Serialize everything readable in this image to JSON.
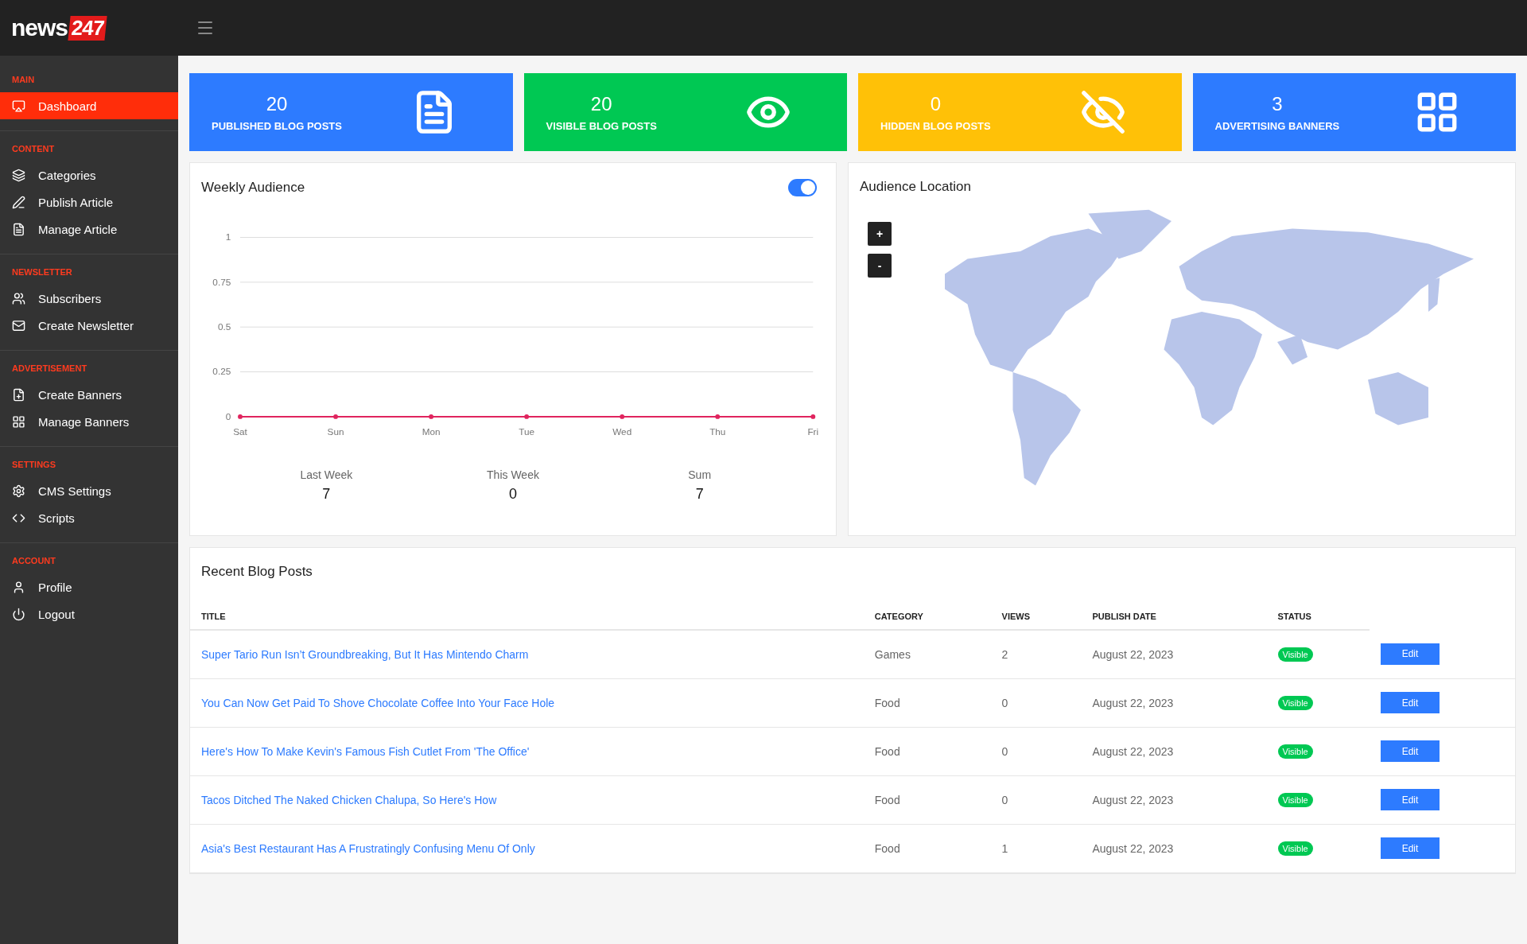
{
  "brand": {
    "name": "news",
    "number": "247"
  },
  "sidebar": {
    "sections": [
      {
        "title": "MAIN",
        "items": [
          {
            "label": "Dashboard",
            "selected": true
          }
        ]
      },
      {
        "title": "CONTENT",
        "items": [
          {
            "label": "Categories",
            "selected": false
          },
          {
            "label": "Publish Article",
            "selected": false
          },
          {
            "label": "Manage Article",
            "selected": false
          }
        ]
      },
      {
        "title": "NEWSLETTER",
        "items": [
          {
            "label": "Subscribers",
            "selected": false
          },
          {
            "label": "Create Newsletter",
            "selected": false
          }
        ]
      },
      {
        "title": "ADVERTISEMENT",
        "items": [
          {
            "label": "Create Banners",
            "selected": false
          },
          {
            "label": "Manage Banners",
            "selected": false
          }
        ]
      },
      {
        "title": "SETTINGS",
        "items": [
          {
            "label": "CMS Settings",
            "selected": false
          },
          {
            "label": "Scripts",
            "selected": false
          }
        ]
      },
      {
        "title": "ACCOUNT",
        "items": [
          {
            "label": "Profile",
            "selected": false
          },
          {
            "label": "Logout",
            "selected": false
          }
        ]
      }
    ]
  },
  "stats": [
    {
      "value": "20",
      "label": "PUBLISHED BLOG POSTS",
      "color": "#2d7bff"
    },
    {
      "value": "20",
      "label": "VISIBLE BLOG POSTS",
      "color": "#00c853"
    },
    {
      "value": "0",
      "label": "HIDDEN BLOG POSTS",
      "color": "#ffc107"
    },
    {
      "value": "3",
      "label": "ADVERTISING BANNERS",
      "color": "#2d7bff"
    }
  ],
  "weekly_audience": {
    "title": "Weekly Audience",
    "toggle": {
      "on": true
    },
    "chart_data": {
      "type": "line",
      "categories": [
        "Sat",
        "Sun",
        "Mon",
        "Tue",
        "Wed",
        "Thu",
        "Fri"
      ],
      "series": [
        {
          "color": "#e0245e",
          "marker": true,
          "values": [
            0,
            0,
            0,
            0,
            0,
            0,
            0
          ]
        }
      ],
      "ylim": [
        0,
        1
      ],
      "yticks": [
        0,
        0.25,
        0.5,
        0.75,
        1
      ],
      "grid": true
    },
    "summary": [
      {
        "label": "Last Week",
        "value": "7"
      },
      {
        "label": "This Week",
        "value": "0"
      },
      {
        "label": "Sum",
        "value": "7"
      }
    ]
  },
  "audience_location": {
    "title": "Audience Location",
    "zoom_in": "+",
    "zoom_out": "-"
  },
  "recent_posts": {
    "title": "Recent Blog Posts",
    "columns": [
      "TITLE",
      "CATEGORY",
      "VIEWS",
      "PUBLISH DATE",
      "STATUS"
    ],
    "rows": [
      {
        "title": "Super Tario Run Isn’t Groundbreaking, But It Has Mintendo Charm",
        "category": "Games",
        "views": "2",
        "date": "August 22, 2023",
        "status": "Visible",
        "action": "Edit"
      },
      {
        "title": "You Can Now Get Paid To Shove Chocolate Coffee Into Your Face Hole",
        "category": "Food",
        "views": "0",
        "date": "August 22, 2023",
        "status": "Visible",
        "action": "Edit"
      },
      {
        "title": "Here's How To Make Kevin's Famous Fish Cutlet From 'The Office'",
        "category": "Food",
        "views": "0",
        "date": "August 22, 2023",
        "status": "Visible",
        "action": "Edit"
      },
      {
        "title": "Tacos Ditched The Naked Chicken Chalupa, So Here's How",
        "category": "Food",
        "views": "0",
        "date": "August 22, 2023",
        "status": "Visible",
        "action": "Edit"
      },
      {
        "title": "Asia's Best Restaurant Has A Frustratingly Confusing Menu Of Only",
        "category": "Food",
        "views": "1",
        "date": "August 22, 2023",
        "status": "Visible",
        "action": "Edit"
      }
    ]
  }
}
